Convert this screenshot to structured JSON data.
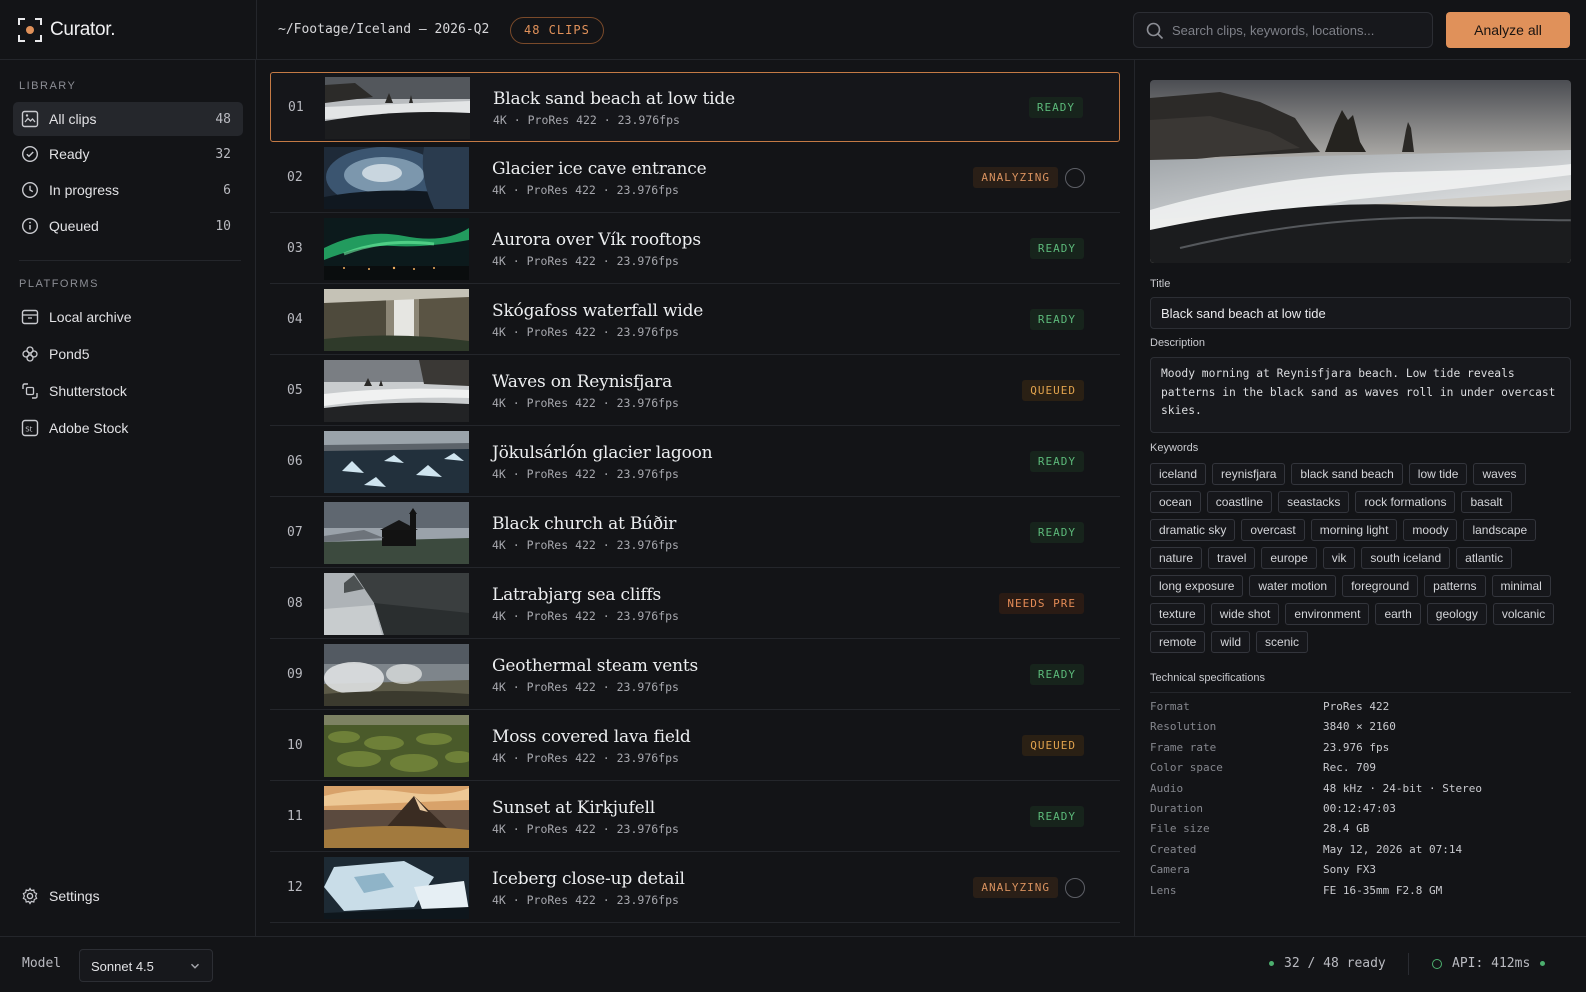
{
  "app": {
    "name": "Curator."
  },
  "header": {
    "path": "~/Footage/Iceland – 2026-Q2",
    "clips_badge": "48 CLIPS",
    "search_placeholder": "Search clips, keywords, locations...",
    "analyze_label": "Analyze all"
  },
  "sidebar": {
    "library_label": "LIBRARY",
    "library": [
      {
        "label": "All clips",
        "count": "48",
        "icon": "grid-image-icon",
        "active": true
      },
      {
        "label": "Ready",
        "count": "32",
        "icon": "check-circle-icon"
      },
      {
        "label": "In progress",
        "count": "6",
        "icon": "clock-icon"
      },
      {
        "label": "Queued",
        "count": "10",
        "icon": "info-circle-icon"
      }
    ],
    "platforms_label": "PLATFORMS",
    "platforms": [
      {
        "label": "Local archive",
        "icon": "archive-icon"
      },
      {
        "label": "Pond5",
        "icon": "flower-icon"
      },
      {
        "label": "Shutterstock",
        "icon": "shutterstock-icon"
      },
      {
        "label": "Adobe Stock",
        "icon": "adobe-stock-icon"
      }
    ],
    "settings_label": "Settings"
  },
  "clips": [
    {
      "num": "01",
      "title": "Black sand beach at low tide",
      "meta": "4K  ·  ProRes 422  ·  23.976fps",
      "status": "READY",
      "kind": "ready",
      "scene": "beach",
      "selected": true
    },
    {
      "num": "02",
      "title": "Glacier ice cave entrance",
      "meta": "4K  ·  ProRes 422  ·  23.976fps",
      "status": "ANALYZING",
      "kind": "analyzing",
      "scene": "cave"
    },
    {
      "num": "03",
      "title": "Aurora over Vík rooftops",
      "meta": "4K  ·  ProRes 422  ·  23.976fps",
      "status": "READY",
      "kind": "ready",
      "scene": "aurora"
    },
    {
      "num": "04",
      "title": "Skógafoss waterfall wide",
      "meta": "4K  ·  ProRes 422  ·  23.976fps",
      "status": "READY",
      "kind": "ready",
      "scene": "waterfall"
    },
    {
      "num": "05",
      "title": "Waves on Reynisfjara",
      "meta": "4K  ·  ProRes 422  ·  23.976fps",
      "status": "QUEUED",
      "kind": "queued",
      "scene": "waves"
    },
    {
      "num": "06",
      "title": "Jökulsárlón glacier lagoon",
      "meta": "4K  ·  ProRes 422  ·  23.976fps",
      "status": "READY",
      "kind": "ready",
      "scene": "lagoon"
    },
    {
      "num": "07",
      "title": "Black church at Búðir",
      "meta": "4K  ·  ProRes 422  ·  23.976fps",
      "status": "READY",
      "kind": "ready",
      "scene": "church"
    },
    {
      "num": "08",
      "title": "Latrabjarg sea cliffs",
      "meta": "4K  ·  ProRes 422  ·  23.976fps",
      "status": "NEEDS PRE",
      "kind": "needs",
      "scene": "cliffs"
    },
    {
      "num": "09",
      "title": "Geothermal steam vents",
      "meta": "4K  ·  ProRes 422  ·  23.976fps",
      "status": "READY",
      "kind": "ready",
      "scene": "steam"
    },
    {
      "num": "10",
      "title": "Moss covered lava field",
      "meta": "4K  ·  ProRes 422  ·  23.976fps",
      "status": "QUEUED",
      "kind": "queued",
      "scene": "moss"
    },
    {
      "num": "11",
      "title": "Sunset at Kirkjufell",
      "meta": "4K  ·  ProRes 422  ·  23.976fps",
      "status": "READY",
      "kind": "ready",
      "scene": "sunset"
    },
    {
      "num": "12",
      "title": "Iceberg close-up detail",
      "meta": "4K  ·  ProRes 422  ·  23.976fps",
      "status": "ANALYZING",
      "kind": "analyzing",
      "scene": "iceberg"
    }
  ],
  "detail": {
    "title_label": "Title",
    "title_value": "Black sand beach at low tide",
    "description_label": "Description",
    "description_value": "Moody morning at Reynisfjara beach. Low tide reveals patterns in the black sand as waves roll in under overcast skies.",
    "keywords_label": "Keywords",
    "keywords": [
      "iceland",
      "reynisfjara",
      "black sand beach",
      "low tide",
      "waves",
      "ocean",
      "coastline",
      "seastacks",
      "rock formations",
      "basalt",
      "dramatic sky",
      "overcast",
      "morning light",
      "moody",
      "landscape",
      "nature",
      "travel",
      "europe",
      "vik",
      "south iceland",
      "atlantic",
      "long exposure",
      "water motion",
      "foreground",
      "patterns",
      "minimal",
      "texture",
      "wide shot",
      "environment",
      "earth",
      "geology",
      "volcanic",
      "remote",
      "wild",
      "scenic"
    ],
    "specs_label": "Technical specifications",
    "specs": [
      {
        "k": "Format",
        "v": "ProRes 422"
      },
      {
        "k": "Resolution",
        "v": "3840 × 2160"
      },
      {
        "k": "Frame rate",
        "v": "23.976 fps"
      },
      {
        "k": "Color space",
        "v": "Rec. 709"
      },
      {
        "k": "Audio",
        "v": "48 kHz · 24-bit · Stereo"
      },
      {
        "k": "Duration",
        "v": "00:12:47:03"
      },
      {
        "k": "File size",
        "v": "28.4 GB"
      },
      {
        "k": "Created",
        "v": "May 12, 2026 at 07:14"
      },
      {
        "k": "Camera",
        "v": "Sony FX3"
      },
      {
        "k": "Lens",
        "v": "FE 16-35mm F2.8 GM"
      }
    ]
  },
  "footer": {
    "model_label": "Model",
    "model_value": "Sonnet 4.5",
    "ready_stat": "32 / 48 ready",
    "api_stat": "API: 412ms"
  },
  "colors": {
    "accent": "#e0915a",
    "ready": "#5cb97a",
    "queued": "#e0a24d",
    "analyzing": "#d9925f",
    "background": "#131417"
  }
}
